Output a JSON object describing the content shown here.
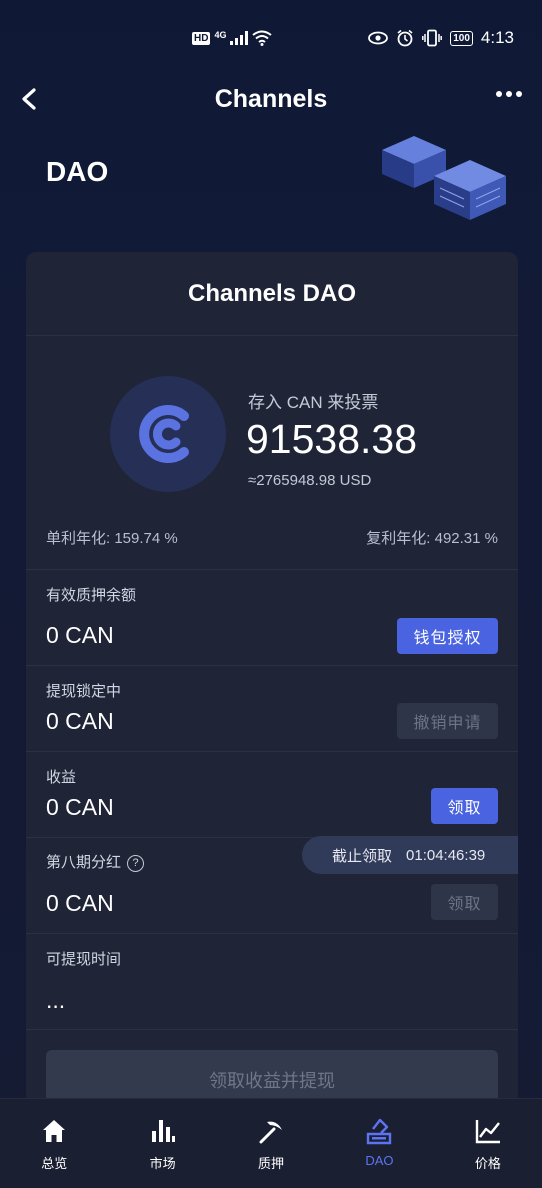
{
  "status_bar": {
    "left_badge": "HD",
    "network": "4G",
    "time": "4:13",
    "battery": "100"
  },
  "header": {
    "title": "Channels"
  },
  "hero": {
    "label": "DAO"
  },
  "card": {
    "title": "Channels DAO",
    "deposit_label": "存入 CAN 来投票",
    "deposit_value": "91538.38",
    "deposit_usd": "≈2765948.98 USD",
    "simple_apr": "单利年化: 159.74 %",
    "compound_apr": "复利年化: 492.31 %",
    "rows": [
      {
        "label": "有效质押余额",
        "value": "0 CAN",
        "button": "钱包授权"
      },
      {
        "label": "提现锁定中",
        "value": "0 CAN",
        "button": "撤销申请"
      },
      {
        "label": "收益",
        "value": "0 CAN",
        "button": "领取"
      },
      {
        "label": "第八期分红",
        "value": "0 CAN",
        "button": "领取"
      },
      {
        "label": "可提现时间",
        "value": "..."
      }
    ],
    "countdown_label": "截止领取",
    "countdown_value": "01:04:46:39",
    "help_glyph": "?",
    "main_button": "领取收益并提现"
  },
  "bottom_nav": {
    "items": [
      {
        "label": "总览",
        "icon": "home-icon"
      },
      {
        "label": "市场",
        "icon": "bar-chart-icon"
      },
      {
        "label": "质押",
        "icon": "pickaxe-icon"
      },
      {
        "label": "DAO",
        "icon": "ballot-box-icon",
        "active": true
      },
      {
        "label": "价格",
        "icon": "line-chart-icon"
      }
    ]
  },
  "colors": {
    "accent": "#4a63e0",
    "active_nav": "#5d74f2",
    "card_bg": "#1f2437",
    "page_bg": "#131a35"
  }
}
